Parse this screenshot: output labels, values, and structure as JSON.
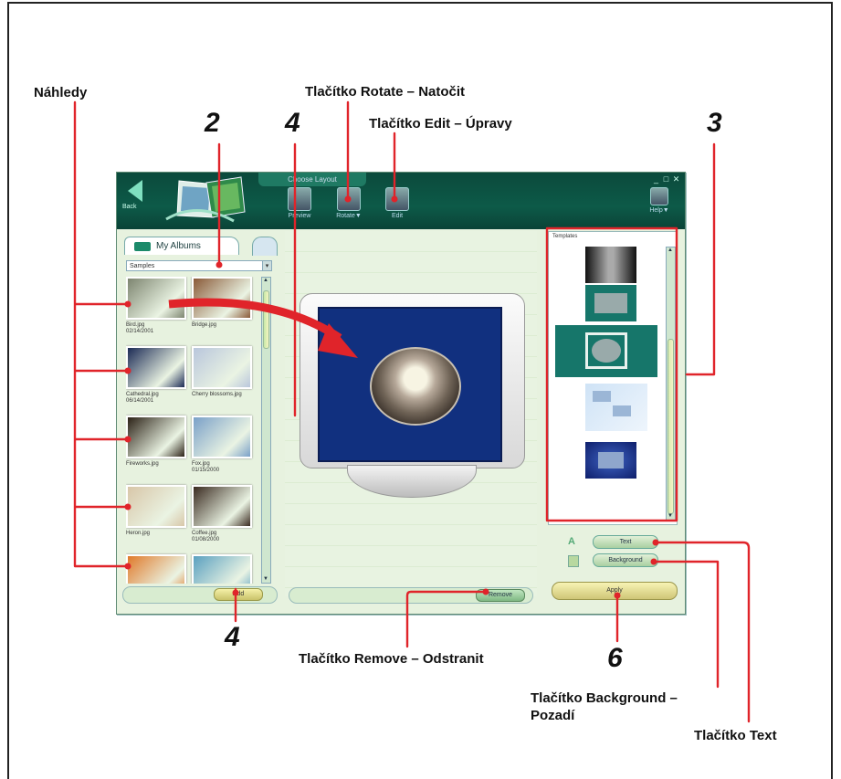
{
  "callouts": {
    "nahledy": "Náhledy",
    "rotate": "Tlačítko Rotate – Natočit",
    "edit": "Tlačítko Edit – Úpravy",
    "remove": "Tlačítko Remove – Odstranit",
    "background_line1": "Tlačítko Background –",
    "background_line2": "Pozadí",
    "text": "Tlačítko Text"
  },
  "numbers": {
    "n2": "2",
    "n4_top": "4",
    "n3": "3",
    "n4_bottom": "4",
    "n6": "6"
  },
  "window": {
    "title": "Choose Layout",
    "controls": [
      "_",
      "□",
      "✕"
    ],
    "back_label": "Back",
    "toolbar": [
      {
        "name": "preview",
        "label": "Preview"
      },
      {
        "name": "rotate",
        "label": "Rotate▼"
      },
      {
        "name": "edit",
        "label": "Edit"
      }
    ],
    "help_label": "Help▼"
  },
  "left_panel": {
    "tab_label": "My Albums",
    "dropdown_value": "Samples",
    "thumbnails": [
      {
        "caption": "Bird.jpg\n02/14/2001",
        "color": "#7d8570"
      },
      {
        "caption": "Bridge.jpg",
        "color": "#8a5a38"
      },
      {
        "caption": "Cathedral.jpg\n06/14/2001",
        "color": "#1b2a55"
      },
      {
        "caption": "Cherry blossoms.jpg",
        "color": "#b9c6dc"
      },
      {
        "caption": "Fireworks.jpg",
        "color": "#2b2116"
      },
      {
        "caption": "Fox.jpg\n01/15/2000",
        "color": "#7aa0c8"
      },
      {
        "caption": "Heron.jpg",
        "color": "#d8c6a8"
      },
      {
        "caption": "Coffee.jpg\n01/08/2000",
        "color": "#3a2a20"
      },
      {
        "caption": "",
        "color": "#e07a2a"
      },
      {
        "caption": "",
        "color": "#5aa0c0"
      }
    ],
    "add_label": "Add"
  },
  "center": {
    "remove_label": "Remove"
  },
  "right_panel": {
    "header": "Templates",
    "text_label": "Text",
    "background_label": "Background",
    "apply_label": "Apply"
  },
  "colors": {
    "title_bar": "#0d5a48",
    "callout_red": "#e0242a",
    "screen_blue": "#11307f"
  }
}
